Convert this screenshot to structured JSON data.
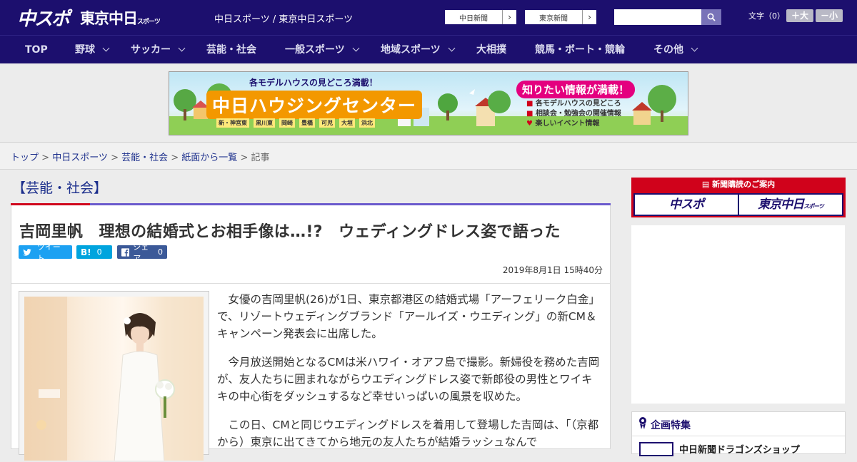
{
  "header": {
    "logo_chuspo": "中スポ",
    "logo_tokyo": "東京中日",
    "logo_tokyo_sub": "スポーツ",
    "site_name": "中日スポーツ / 東京中日スポーツ",
    "paper_links": [
      "中日新聞",
      "東京新聞"
    ],
    "search_placeholder": "",
    "font_size_label": "文字（0）",
    "font_larger": "＋大",
    "font_smaller": "－小"
  },
  "nav": {
    "items": [
      {
        "label": "TOP",
        "dropdown": false
      },
      {
        "label": "野球",
        "dropdown": true
      },
      {
        "label": "サッカー",
        "dropdown": true
      },
      {
        "label": "芸能・社会",
        "dropdown": false
      },
      {
        "label": "一般スポーツ",
        "dropdown": true
      },
      {
        "label": "地域スポーツ",
        "dropdown": true
      },
      {
        "label": "大相撲",
        "dropdown": false
      },
      {
        "label": "競馬・ボート・競輪",
        "dropdown": false
      },
      {
        "label": "その他",
        "dropdown": true
      }
    ]
  },
  "banner": {
    "top_text": "各モデルハウスの見どころ満載！",
    "title": "中日ハウジングセンター",
    "locations": [
      "新・神宮東",
      "黒川東",
      "岡崎",
      "豊橋",
      "可児",
      "大垣",
      "浜北"
    ],
    "badge": "知りたい情報が満載！",
    "bullets": [
      "各モデルハウスの見どころ",
      "相談会・勉強会の開催情報",
      "楽しいイベント情報"
    ]
  },
  "breadcrumb": {
    "items": [
      "トップ",
      "中日スポーツ",
      "芸能・社会",
      "紙面から一覧"
    ],
    "current": "記事",
    "sep": " > "
  },
  "article": {
    "category": "【芸能・社会】",
    "headline": "吉岡里帆　理想の結婚式とお相手像は…!?　ウェディングドレス姿で語った",
    "share": {
      "tweet_label": "ツイート",
      "hatena_label": "B!",
      "hatena_count": "0",
      "facebook_label": "シェア",
      "facebook_count": "0"
    },
    "datetime": "2019年8月1日 15時40分",
    "paragraphs": [
      "女優の吉岡里帆(26)が1日、東京都港区の結婚式場「アーフェリーク白金」で、リゾートウェディングブランド「アールイズ・ウエディング」の新CM＆キャンペーン発表会に出席した。",
      "今月放送開始となるCMは米ハワイ・オアフ島で撮影。新婦役を務めた吉岡が、友人たちに囲まれながらウエディングドレス姿で新郎役の男性とワイキキの中心街をダッシュするなど幸せいっぱいの風景を収めた。",
      "この日、CMと同じウエディングドレスを着用して登場した吉岡は、「（京都から）東京に出てきてから地元の友人たちが結婚ラッシュなんで"
    ]
  },
  "sidebar": {
    "subscribe_title": "新聞購読のご案内",
    "subscribe_boxes": [
      "中スポ",
      "東京中日"
    ],
    "subscribe_box2_sub": "スポーツ",
    "feature_title": "企画特集",
    "feature_item": "中日新聞ドラゴンズショップ"
  },
  "colors": {
    "navy": "#1c0f6e",
    "link": "#1c2f8c",
    "red": "#d0021b",
    "twitter": "#1da1f2",
    "hatena": "#00a4de",
    "facebook": "#3b5998"
  }
}
